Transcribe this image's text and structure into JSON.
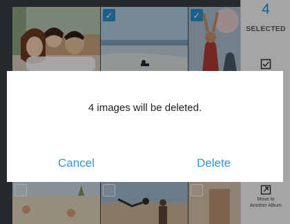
{
  "gallery": {
    "photos": [
      {
        "id": "family",
        "selected": false
      },
      {
        "id": "beach-jetski",
        "selected": true
      },
      {
        "id": "celebration",
        "selected": true
      },
      {
        "id": "bottom-left",
        "selected": false
      },
      {
        "id": "bottom-middle",
        "selected": false
      },
      {
        "id": "bottom-right",
        "selected": false
      }
    ],
    "check_mark": "✓"
  },
  "sidebar": {
    "count": "4",
    "selected_label": "SELECTED",
    "select_all_icon": "checkbox-icon",
    "move_icon": "move-album-icon",
    "move_label_line1": "Move to",
    "move_label_line2": "Another Album"
  },
  "dialog": {
    "message": "4 images will be deleted.",
    "cancel_label": "Cancel",
    "delete_label": "Delete"
  },
  "colors": {
    "accent": "#2f96d6",
    "check_bg": "#2b8fd0"
  }
}
